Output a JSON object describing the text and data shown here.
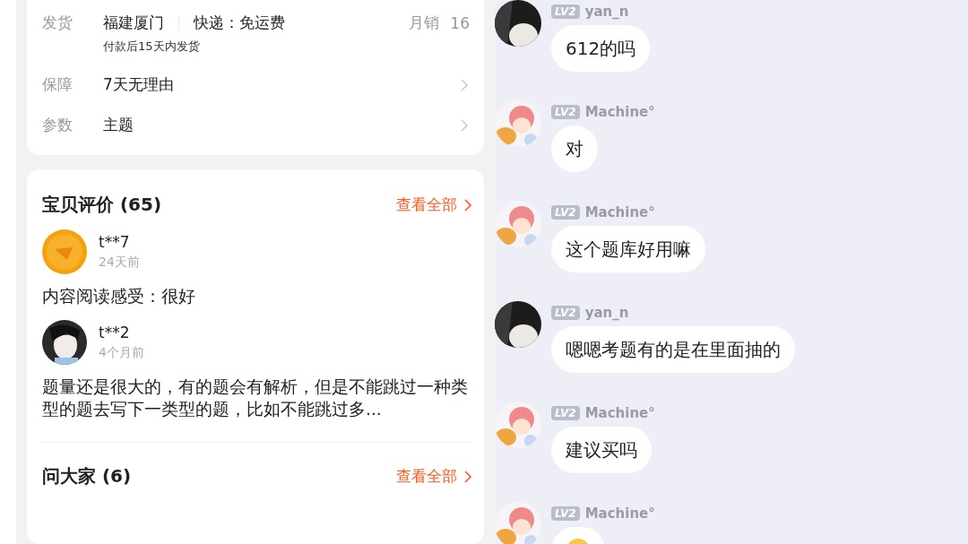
{
  "product_info": {
    "rows": [
      {
        "kind": "shipping",
        "label": "发货",
        "origin": "福建厦门",
        "delivery": "快递：免运费",
        "sales_label": "月销",
        "sales": "16",
        "note": "付款后15天内发货"
      },
      {
        "kind": "link",
        "label": "保障",
        "value": "7天无理由"
      },
      {
        "kind": "link",
        "label": "参数",
        "value": "主题"
      }
    ]
  },
  "reviews": {
    "title": "宝贝评价",
    "count": "(65)",
    "view_all": "查看全部",
    "items": [
      {
        "user": "t**7",
        "time": "24天前",
        "text": "内容阅读感受：很好"
      },
      {
        "user": "t**2",
        "time": "4个月前",
        "text": "题量还是很大的，有的题会有解析，但是不能跳过一种类型的题去写下一类型的题，比如不能跳过多..."
      }
    ]
  },
  "questions": {
    "title": "问大家",
    "count": "(6)",
    "view_all": "查看全部"
  },
  "chat": {
    "messages": [
      {
        "level": "LV2",
        "user": "yan_n",
        "kind": "text",
        "text": "612的吗"
      },
      {
        "level": "LV2",
        "user": "Machine°",
        "kind": "text",
        "text": "对"
      },
      {
        "level": "LV2",
        "user": "Machine°",
        "kind": "text",
        "text": "这个题库好用嘛"
      },
      {
        "level": "LV2",
        "user": "yan_n",
        "kind": "text",
        "text": "嗯嗯考题有的是在里面抽的"
      },
      {
        "level": "LV2",
        "user": "Machine°",
        "kind": "text",
        "text": "建议买吗"
      },
      {
        "level": "LV2",
        "user": "Machine°",
        "kind": "emoji"
      }
    ]
  }
}
